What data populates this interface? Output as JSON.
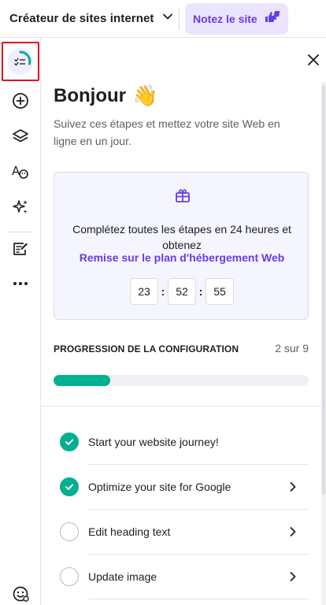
{
  "header": {
    "site_selector_label": "Créateur de sites internet",
    "rate_button_label": "Notez le site"
  },
  "rail": {
    "items": [
      "checklist-progress-icon",
      "add-icon",
      "layers-icon",
      "styles-icon",
      "ai-sparkle-icon",
      "blog-edit-icon",
      "more-icon",
      "help-face-icon"
    ]
  },
  "panel": {
    "title": "Bonjour",
    "title_emoji": "👋",
    "subtitle": "Suivez ces étapes et mettez votre site Web en ligne en un jour.",
    "offer": {
      "text": "Complétez toutes les étapes en 24 heures et obtenez",
      "link": "Remise sur le plan d'hébergement Web",
      "timer": {
        "hours": "23",
        "minutes": "52",
        "seconds": "55"
      }
    },
    "progress": {
      "label": "PROGRESSION DE LA CONFIGURATION",
      "count_text": "2 sur 9",
      "completed": 2,
      "total": 9
    },
    "steps": [
      {
        "label": "Start your website journey!",
        "done": true,
        "has_chevron": false
      },
      {
        "label": "Optimize your site for Google",
        "done": true,
        "has_chevron": true
      },
      {
        "label": "Edit heading text",
        "done": false,
        "has_chevron": true
      },
      {
        "label": "Update image",
        "done": false,
        "has_chevron": true
      }
    ]
  },
  "colors": {
    "accent": "#673de6",
    "accent_bg": "#ebe4ff",
    "success": "#00b090",
    "highlight_border": "#e0101e"
  }
}
